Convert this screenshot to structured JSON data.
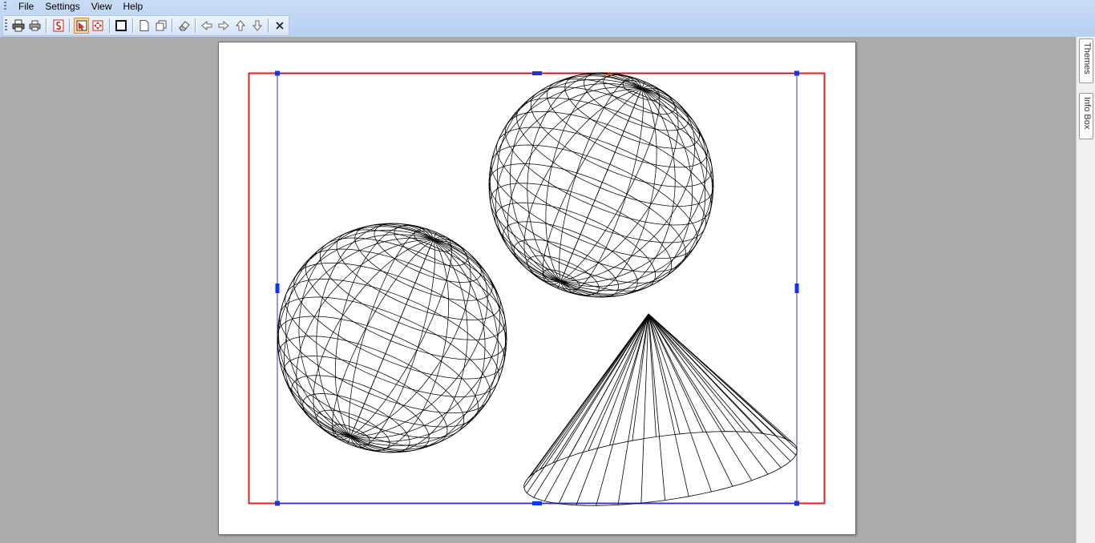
{
  "menubar": {
    "items": [
      "File",
      "Settings",
      "View",
      "Help"
    ]
  },
  "toolbar": {
    "buttons": [
      {
        "name": "print-icon",
        "active": false
      },
      {
        "name": "print-preview-icon",
        "active": false
      },
      {
        "name": "export-icon",
        "active": false
      },
      {
        "name": "select-tool-icon",
        "active": true
      },
      {
        "name": "move-tool-icon",
        "active": false
      },
      {
        "name": "frame-icon",
        "active": false
      },
      {
        "name": "new-page-icon",
        "active": false
      },
      {
        "name": "copy-page-icon",
        "active": false
      },
      {
        "name": "eraser-icon",
        "active": false
      },
      {
        "name": "arrow-left-icon",
        "active": false
      },
      {
        "name": "arrow-right-icon",
        "active": false
      },
      {
        "name": "arrow-up-icon",
        "active": false
      },
      {
        "name": "arrow-down-icon",
        "active": false
      },
      {
        "name": "close-icon",
        "active": false
      }
    ]
  },
  "sidepanel": {
    "tabs": [
      "Themes",
      "Info Box"
    ]
  },
  "canvas": {
    "shapes": [
      "wireframe-sphere",
      "wireframe-sphere",
      "wireframe-cone"
    ],
    "colors": {
      "outer_frame": "#dd2222",
      "selection": "#3333cc",
      "handle": "#1133ee",
      "lines": "#000000"
    }
  }
}
